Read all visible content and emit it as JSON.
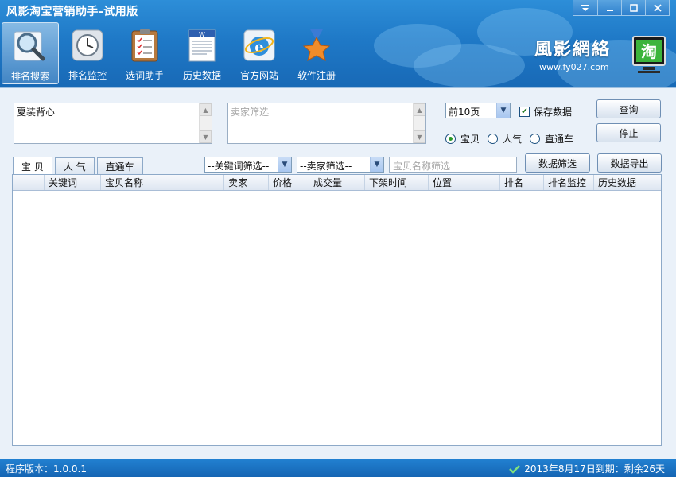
{
  "app": {
    "title": "风影淘宝营销助手-试用版",
    "window_controls": [
      "menu",
      "minimize",
      "maximize",
      "close"
    ]
  },
  "toolbar": [
    {
      "label": "排名搜索",
      "icon": "magnifier-icon",
      "active": true
    },
    {
      "label": "排名监控",
      "icon": "clock-icon",
      "active": false
    },
    {
      "label": "选词助手",
      "icon": "clipboard-icon",
      "active": false
    },
    {
      "label": "历史数据",
      "icon": "document-icon",
      "active": false
    },
    {
      "label": "官方网站",
      "icon": "ie-browser-icon",
      "active": false
    },
    {
      "label": "软件注册",
      "icon": "medal-icon",
      "active": false
    }
  ],
  "brand": {
    "name": "風影網絡",
    "url": "www.fy027.com",
    "logo_char": "淘"
  },
  "search": {
    "keyword_value": "夏装背心",
    "seller_placeholder": "卖家筛选",
    "pages_select": "前10页",
    "save_data_label": "保存数据",
    "save_data_checked": true,
    "mode_options": [
      {
        "label": "宝贝",
        "checked": true
      },
      {
        "label": "人气",
        "checked": false
      },
      {
        "label": "直通车",
        "checked": false
      }
    ],
    "query_button": "查询",
    "stop_button": "停止"
  },
  "tabs": [
    {
      "label": "宝 贝",
      "active": true
    },
    {
      "label": "人 气",
      "active": false
    },
    {
      "label": "直通车",
      "active": false
    }
  ],
  "filters": {
    "keyword_filter": "--关键词筛选--",
    "seller_filter": "--卖家筛选--",
    "item_name_placeholder": "宝贝名称筛选",
    "filter_button": "数据筛选",
    "export_button": "数据导出"
  },
  "grid": {
    "columns": [
      "",
      "关键词",
      "宝贝名称",
      "卖家",
      "价格",
      "成交量",
      "下架时间",
      "位置",
      "排名",
      "排名监控",
      "历史数据"
    ],
    "rows": []
  },
  "status": {
    "version_label": "程序版本：1.0.0.1",
    "expiry_text": "2013年8月17日到期：剩余26天"
  },
  "colors": {
    "header_blue": "#1f79c7",
    "content_bg": "#eaf1f9",
    "status_blue": "#1a6fc0"
  }
}
